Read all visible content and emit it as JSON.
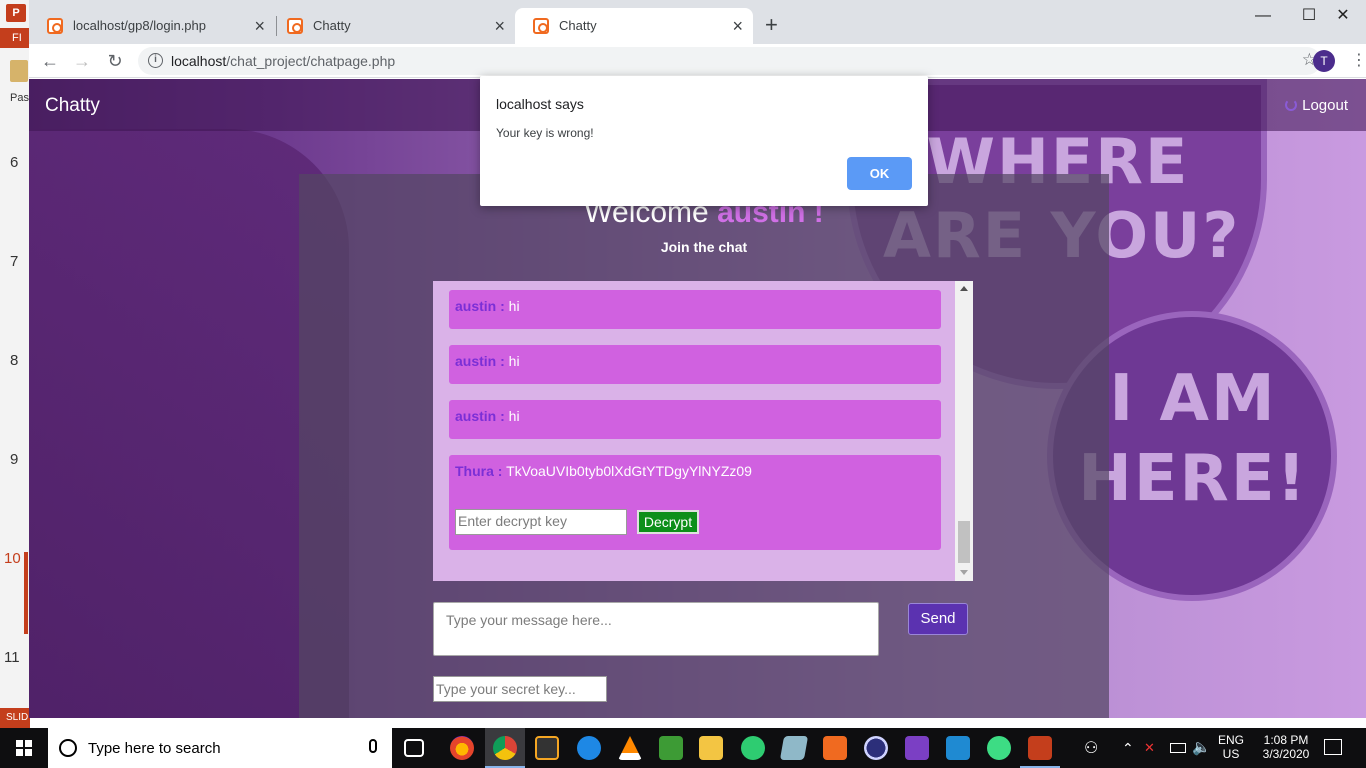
{
  "background_app": {
    "logo": "P",
    "ribbon_tab": "FI",
    "paste_label": "Pas",
    "slide_numbers": [
      "6",
      "7",
      "8",
      "9",
      "10",
      "11"
    ],
    "status": "SLID"
  },
  "browser": {
    "tabs": [
      {
        "title": "localhost/gp8/login.php"
      },
      {
        "title": "Chatty"
      },
      {
        "title": "Chatty"
      }
    ],
    "new_tab": "+",
    "window_controls": {
      "minimize": "—",
      "maximize": "☐",
      "close": "✕"
    },
    "url_host": "localhost",
    "url_path": "/chat_project/chatpage.php",
    "profile_initial": "T"
  },
  "page": {
    "brand": "Chatty",
    "logout_label": "Logout",
    "welcome_prefix": "Welcome ",
    "username": "austin !",
    "subtitle": "Join the chat",
    "background_text": {
      "bubble1": "WHERE\nARE YOU?",
      "bubble2": "I AM\nHERE!"
    },
    "messages": [
      {
        "sender": "austin :",
        "text": " hi"
      },
      {
        "sender": "austin :",
        "text": " hi"
      },
      {
        "sender": "austin :",
        "text": " hi"
      },
      {
        "sender": "Thura :",
        "text": " TkVoaUVIb0tyb0lXdGtYTDgyYlNYZz09"
      }
    ],
    "decrypt_placeholder": "Enter decrypt key",
    "decrypt_button": "Decrypt",
    "message_placeholder": "Type your message here...",
    "send_button": "Send",
    "secret_placeholder": "Type your secret key..."
  },
  "alert": {
    "title": "localhost says",
    "message": "Your key is wrong!",
    "ok_label": "OK"
  },
  "taskbar": {
    "search_placeholder": "Type here to search",
    "language": "ENG",
    "region": "US",
    "time": "1:08 PM",
    "date": "3/3/2020"
  },
  "colors": {
    "accent_purple": "#d061e0",
    "sender_purple": "#7b2fd6",
    "decrypt_green": "#0d8f1a",
    "send_button": "#5b32b0",
    "ok_button": "#5b9af6"
  }
}
